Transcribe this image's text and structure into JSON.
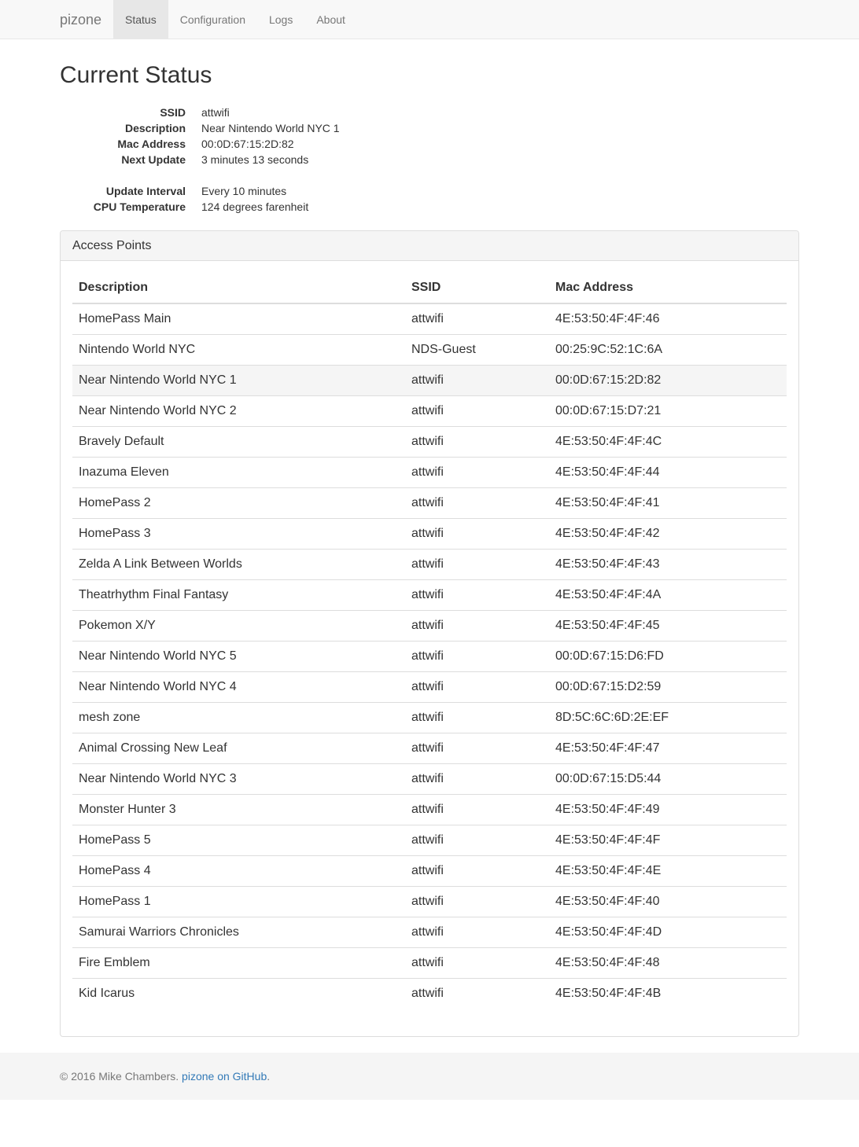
{
  "nav": {
    "brand": "pizone",
    "items": [
      {
        "label": "Status",
        "active": true
      },
      {
        "label": "Configuration",
        "active": false
      },
      {
        "label": "Logs",
        "active": false
      },
      {
        "label": "About",
        "active": false
      }
    ]
  },
  "page": {
    "title": "Current Status"
  },
  "status": {
    "ssid_label": "SSID",
    "ssid": "attwifi",
    "description_label": "Description",
    "description": "Near Nintendo World NYC 1",
    "mac_label": "Mac Address",
    "mac": "00:0D:67:15:2D:82",
    "next_update_label": "Next Update",
    "next_update": "3 minutes 13 seconds",
    "interval_label": "Update Interval",
    "interval": "Every 10 minutes",
    "cpu_label": "CPU Temperature",
    "cpu": "124 degrees farenheit"
  },
  "access_points": {
    "heading": "Access Points",
    "columns": [
      "Description",
      "SSID",
      "Mac Address"
    ],
    "rows": [
      [
        "HomePass Main",
        "attwifi",
        "4E:53:50:4F:4F:46"
      ],
      [
        "Nintendo World NYC",
        "NDS-Guest",
        "00:25:9C:52:1C:6A"
      ],
      [
        "Near Nintendo World NYC 1",
        "attwifi",
        "00:0D:67:15:2D:82"
      ],
      [
        "Near Nintendo World NYC 2",
        "attwifi",
        "00:0D:67:15:D7:21"
      ],
      [
        "Bravely Default",
        "attwifi",
        "4E:53:50:4F:4F:4C"
      ],
      [
        "Inazuma Eleven",
        "attwifi",
        "4E:53:50:4F:4F:44"
      ],
      [
        "HomePass 2",
        "attwifi",
        "4E:53:50:4F:4F:41"
      ],
      [
        "HomePass 3",
        "attwifi",
        "4E:53:50:4F:4F:42"
      ],
      [
        "Zelda A Link Between Worlds",
        "attwifi",
        "4E:53:50:4F:4F:43"
      ],
      [
        "Theatrhythm Final Fantasy",
        "attwifi",
        "4E:53:50:4F:4F:4A"
      ],
      [
        "Pokemon X/Y",
        "attwifi",
        "4E:53:50:4F:4F:45"
      ],
      [
        "Near Nintendo World NYC 5",
        "attwifi",
        "00:0D:67:15:D6:FD"
      ],
      [
        "Near Nintendo World NYC 4",
        "attwifi",
        "00:0D:67:15:D2:59"
      ],
      [
        "mesh zone",
        "attwifi",
        "8D:5C:6C:6D:2E:EF"
      ],
      [
        "Animal Crossing New Leaf",
        "attwifi",
        "4E:53:50:4F:4F:47"
      ],
      [
        "Near Nintendo World NYC 3",
        "attwifi",
        "00:0D:67:15:D5:44"
      ],
      [
        "Monster Hunter 3",
        "attwifi",
        "4E:53:50:4F:4F:49"
      ],
      [
        "HomePass 5",
        "attwifi",
        "4E:53:50:4F:4F:4F"
      ],
      [
        "HomePass 4",
        "attwifi",
        "4E:53:50:4F:4F:4E"
      ],
      [
        "HomePass 1",
        "attwifi",
        "4E:53:50:4F:4F:40"
      ],
      [
        "Samurai Warriors Chronicles",
        "attwifi",
        "4E:53:50:4F:4F:4D"
      ],
      [
        "Fire Emblem",
        "attwifi",
        "4E:53:50:4F:4F:48"
      ],
      [
        "Kid Icarus",
        "attwifi",
        "4E:53:50:4F:4F:4B"
      ]
    ],
    "highlighted_row": 2
  },
  "footer": {
    "copyright": "© 2016 Mike Chambers. ",
    "link_text": "pizone on GitHub",
    "suffix": "."
  }
}
